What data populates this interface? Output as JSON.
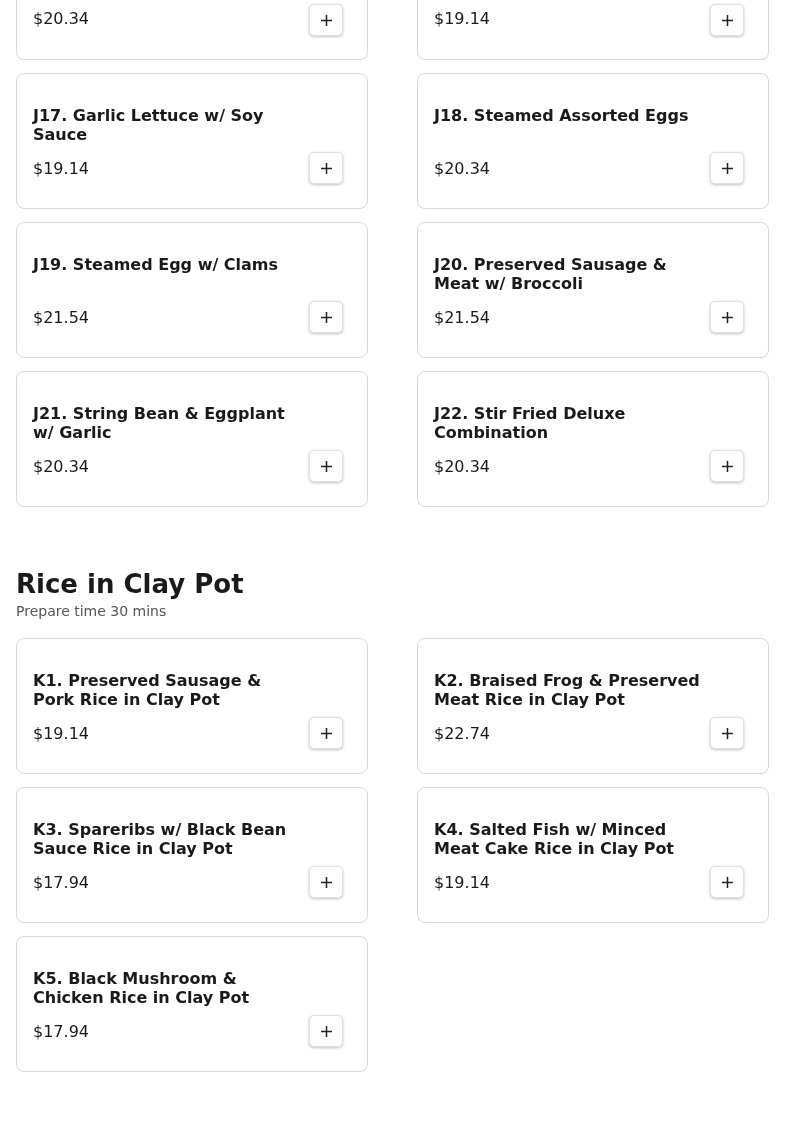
{
  "sections": [
    {
      "items": [
        {
          "kind": "partial",
          "price": "$20.34"
        },
        {
          "kind": "partial",
          "price": "$19.14"
        },
        {
          "kind": "full",
          "name": "J17. Garlic Lettuce w/ Soy Sauce",
          "price": "$19.14"
        },
        {
          "kind": "full",
          "name": "J18. Steamed Assorted Eggs",
          "price": "$20.34"
        },
        {
          "kind": "full",
          "name": "J19. Steamed Egg w/ Clams",
          "price": "$21.54"
        },
        {
          "kind": "full",
          "name": "J20. Preserved Sausage & Meat w/ Broccoli",
          "price": "$21.54"
        },
        {
          "kind": "full",
          "name": "J21. String Bean & Eggplant w/ Garlic",
          "price": "$20.34"
        },
        {
          "kind": "full",
          "name": "J22. Stir Fried Deluxe Combination",
          "price": "$20.34"
        }
      ]
    },
    {
      "title": "Rice in Clay Pot",
      "subtitle": "Prepare time 30 mins",
      "items": [
        {
          "kind": "full",
          "name": "K1. Preserved Sausage & Pork Rice in Clay Pot",
          "price": "$19.14"
        },
        {
          "kind": "full",
          "name": "K2. Braised Frog & Preserved Meat Rice in Clay Pot",
          "price": "$22.74"
        },
        {
          "kind": "full",
          "name": "K3. Spareribs w/ Black Bean Sauce Rice in Clay Pot",
          "price": "$17.94"
        },
        {
          "kind": "full",
          "name": "K4. Salted Fish w/ Minced Meat Cake Rice in Clay Pot",
          "price": "$19.14"
        },
        {
          "kind": "full",
          "name": "K5. Black Mushroom & Chicken Rice in Clay Pot",
          "price": "$17.94"
        }
      ]
    }
  ]
}
